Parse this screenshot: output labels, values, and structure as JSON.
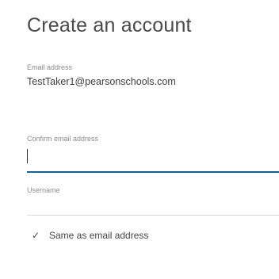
{
  "form": {
    "title": "Create an account",
    "email": {
      "label": "Email address",
      "value": "TestTaker1@pearsonschools.com"
    },
    "confirm_email": {
      "label": "Confirm email address",
      "value": ""
    },
    "username": {
      "label": "Username",
      "value": ""
    },
    "same_as_email": {
      "checked_glyph": "✓",
      "label": "Same as email address"
    }
  }
}
